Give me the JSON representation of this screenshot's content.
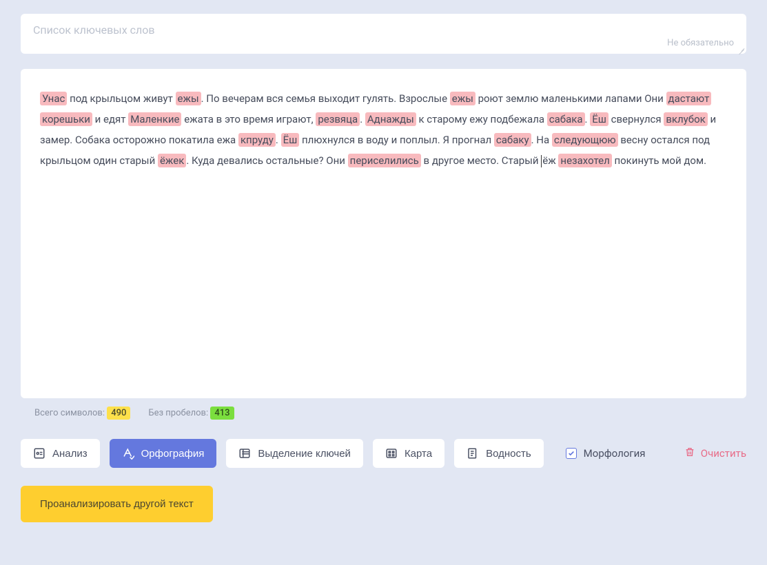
{
  "keywords": {
    "placeholder": "Список ключевых слов",
    "optional": "Не обязательно"
  },
  "text": {
    "segments": [
      {
        "hl": true,
        "t": "Унас"
      },
      {
        "hl": false,
        "t": " под крыльцом живут "
      },
      {
        "hl": true,
        "t": "ежы"
      },
      {
        "hl": false,
        "t": ". По вечерам вся семья выходит гулять. Взрослые "
      },
      {
        "hl": true,
        "t": "ежы"
      },
      {
        "hl": false,
        "t": " роют землю маленькими лапами Они "
      },
      {
        "hl": true,
        "t": "дастают"
      },
      {
        "hl": false,
        "t": " "
      },
      {
        "hl": true,
        "t": "корешьки"
      },
      {
        "hl": false,
        "t": " и едят "
      },
      {
        "hl": true,
        "t": "Маленкие"
      },
      {
        "hl": false,
        "t": " ежата в это время играют, "
      },
      {
        "hl": true,
        "t": "резвяца"
      },
      {
        "hl": false,
        "t": ". "
      },
      {
        "hl": true,
        "t": "Аднажды"
      },
      {
        "hl": false,
        "t": " к старому ежу подбежала "
      },
      {
        "hl": true,
        "t": "сабака"
      },
      {
        "hl": false,
        "t": ". "
      },
      {
        "hl": true,
        "t": "Ёш"
      },
      {
        "hl": false,
        "t": " свернулся "
      },
      {
        "hl": true,
        "t": "вклубок"
      },
      {
        "hl": false,
        "t": " и замер. Собака осторожно покатила ежа "
      },
      {
        "hl": true,
        "t": "кпруду"
      },
      {
        "hl": false,
        "t": ". "
      },
      {
        "hl": true,
        "t": "Ёш"
      },
      {
        "hl": false,
        "t": " плюхнулся в воду и поплыл. Я прогнал "
      },
      {
        "hl": true,
        "t": "сабаку"
      },
      {
        "hl": false,
        "t": ". На "
      },
      {
        "hl": true,
        "t": "следующюю"
      },
      {
        "hl": false,
        "t": " весну остался под крыльцом один старый "
      },
      {
        "hl": true,
        "t": "ёжек"
      },
      {
        "hl": false,
        "t": ". Куда девались остальные? Они "
      },
      {
        "hl": true,
        "t": "периселились"
      },
      {
        "hl": false,
        "t": " в другое место. Старый "
      },
      {
        "cursor": true
      },
      {
        "hl": false,
        "t": "ёж "
      },
      {
        "hl": true,
        "t": "незахотел"
      },
      {
        "hl": false,
        "t": " покинуть мой дом."
      }
    ]
  },
  "stats": {
    "total_label": "Всего символов:",
    "total_value": "490",
    "nospaces_label": "Без пробелов:",
    "nospaces_value": "413"
  },
  "toolbar": {
    "analysis": "Анализ",
    "spelling": "Орфография",
    "keys": "Выделение ключей",
    "map": "Карта",
    "water": "Водность",
    "morphology": "Морфология",
    "clear": "Очистить"
  },
  "analyze_other": "Проанализировать другой текст"
}
